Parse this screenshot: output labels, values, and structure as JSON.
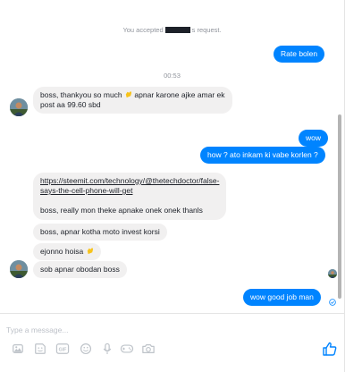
{
  "conversation": {
    "accepted_notice": {
      "before": "You accepted",
      "after": "s request."
    },
    "timestamp": "00:53",
    "messages": [
      {
        "direction": "outgoing",
        "text": "Rate bolen"
      },
      {
        "direction": "incoming",
        "line1": "boss, thankyou so much",
        "line1_after": "apnar karone ajke amar ek",
        "line2": "post aa 99.60 sbd"
      },
      {
        "direction": "outgoing",
        "text": "wow"
      },
      {
        "direction": "outgoing",
        "text": "how ? ato inkam ki vabe korlen ?"
      },
      {
        "direction": "incoming",
        "link_line1": "https://steemit.com/technology/@thetechdoctor/false-",
        "link_line2": "says-the-cell-phone-will-get",
        "text": "boss, really mon theke apnake onek onek thanls"
      },
      {
        "direction": "incoming",
        "text": "boss, apnar kotha moto invest korsi"
      },
      {
        "direction": "incoming",
        "text": "ejonno hoisa"
      },
      {
        "direction": "incoming",
        "text": "sob apnar obodan boss"
      },
      {
        "direction": "outgoing",
        "text": "wow good job man"
      }
    ]
  },
  "composer": {
    "placeholder": "Type a message...",
    "tools": [
      "sticker-icon",
      "gif-icon",
      "emoji-icon",
      "microphone-icon",
      "game-controller-icon",
      "camera-icon",
      "photo-icon"
    ]
  },
  "colors": {
    "outgoing_bubble": "#0084ff",
    "incoming_bubble": "#f1f0f0",
    "like_icon": "#0084ff",
    "tool_icon": "#bec3c9"
  }
}
